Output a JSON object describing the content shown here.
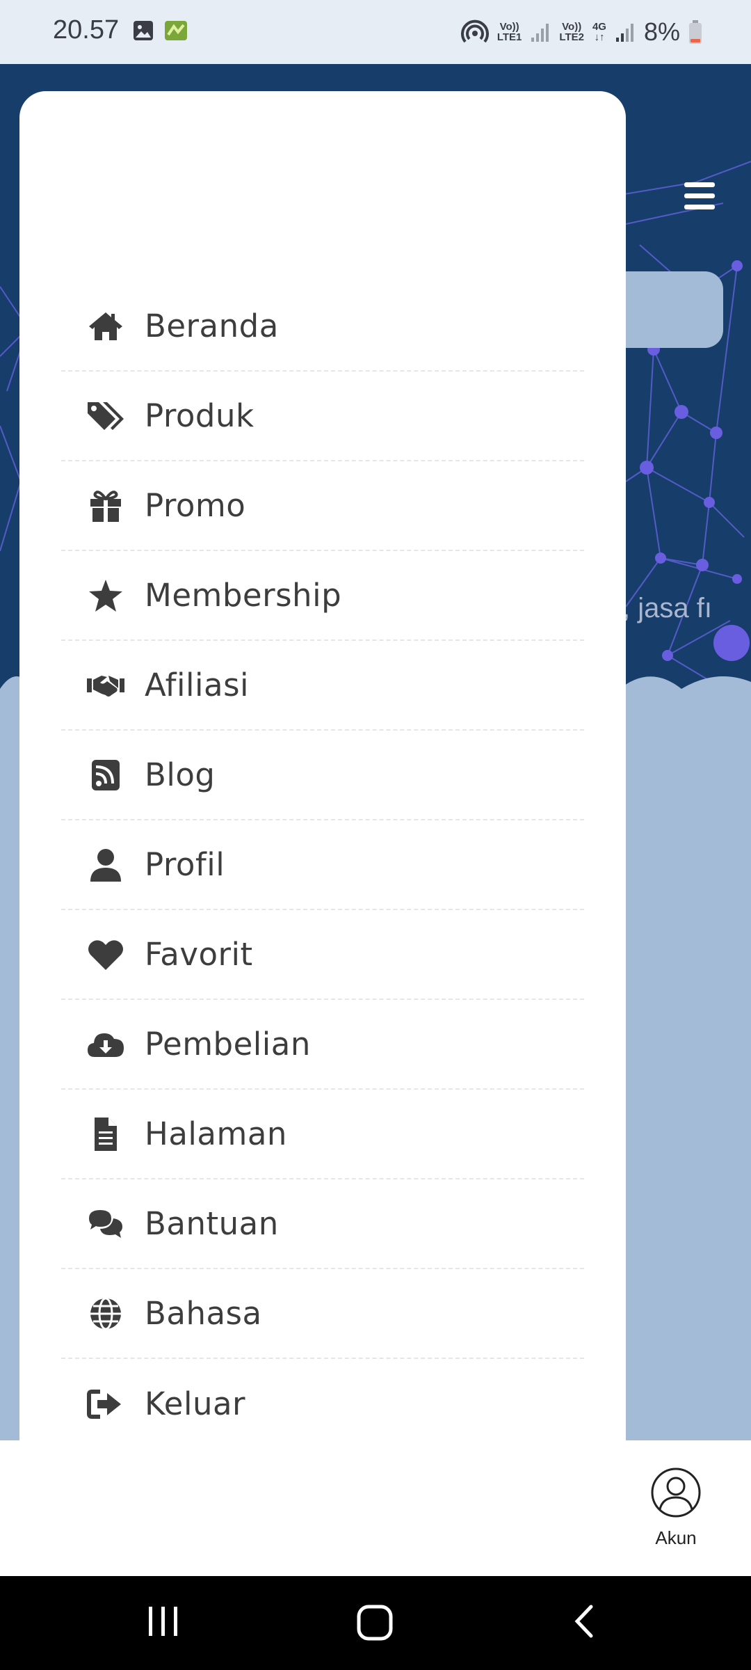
{
  "status_bar": {
    "time": "20.57",
    "battery": "8%",
    "sim1_top": "Vo))",
    "sim1_bottom": "LTE1",
    "sim2_top": "Vo))",
    "sim2_bottom": "LTE2",
    "network": "4G",
    "icons": [
      "gallery-icon",
      "app-notification-icon",
      "hotspot-icon",
      "signal-icon",
      "battery-icon"
    ]
  },
  "header": {
    "menu_icon": "hamburger-icon",
    "partial_text": ", jasa fı"
  },
  "drawer": {
    "items": [
      {
        "label": "Beranda",
        "icon": "home-icon"
      },
      {
        "label": "Produk",
        "icon": "tags-icon"
      },
      {
        "label": "Promo",
        "icon": "gift-icon"
      },
      {
        "label": "Membership",
        "icon": "star-icon"
      },
      {
        "label": "Afiliasi",
        "icon": "handshake-icon"
      },
      {
        "label": "Blog",
        "icon": "rss-icon"
      },
      {
        "label": "Profil",
        "icon": "user-icon"
      },
      {
        "label": "Favorit",
        "icon": "heart-icon"
      },
      {
        "label": "Pembelian",
        "icon": "cloud-download-icon"
      },
      {
        "label": "Halaman",
        "icon": "file-icon"
      },
      {
        "label": "Bantuan",
        "icon": "comments-icon"
      },
      {
        "label": "Bahasa",
        "icon": "globe-icon"
      },
      {
        "label": "Keluar",
        "icon": "sign-out-icon"
      }
    ]
  },
  "bottom_nav": {
    "account_label": "Akun",
    "account_icon": "user-circle-icon"
  },
  "system_nav": {
    "icons": [
      "recent-apps-icon",
      "home-button-icon",
      "back-icon"
    ]
  },
  "colors": {
    "header_bg": "#173d6b",
    "page_bg": "#a3bbd6",
    "network_nodes": "#6a5ee0",
    "menu_text": "#3d3d3d"
  }
}
